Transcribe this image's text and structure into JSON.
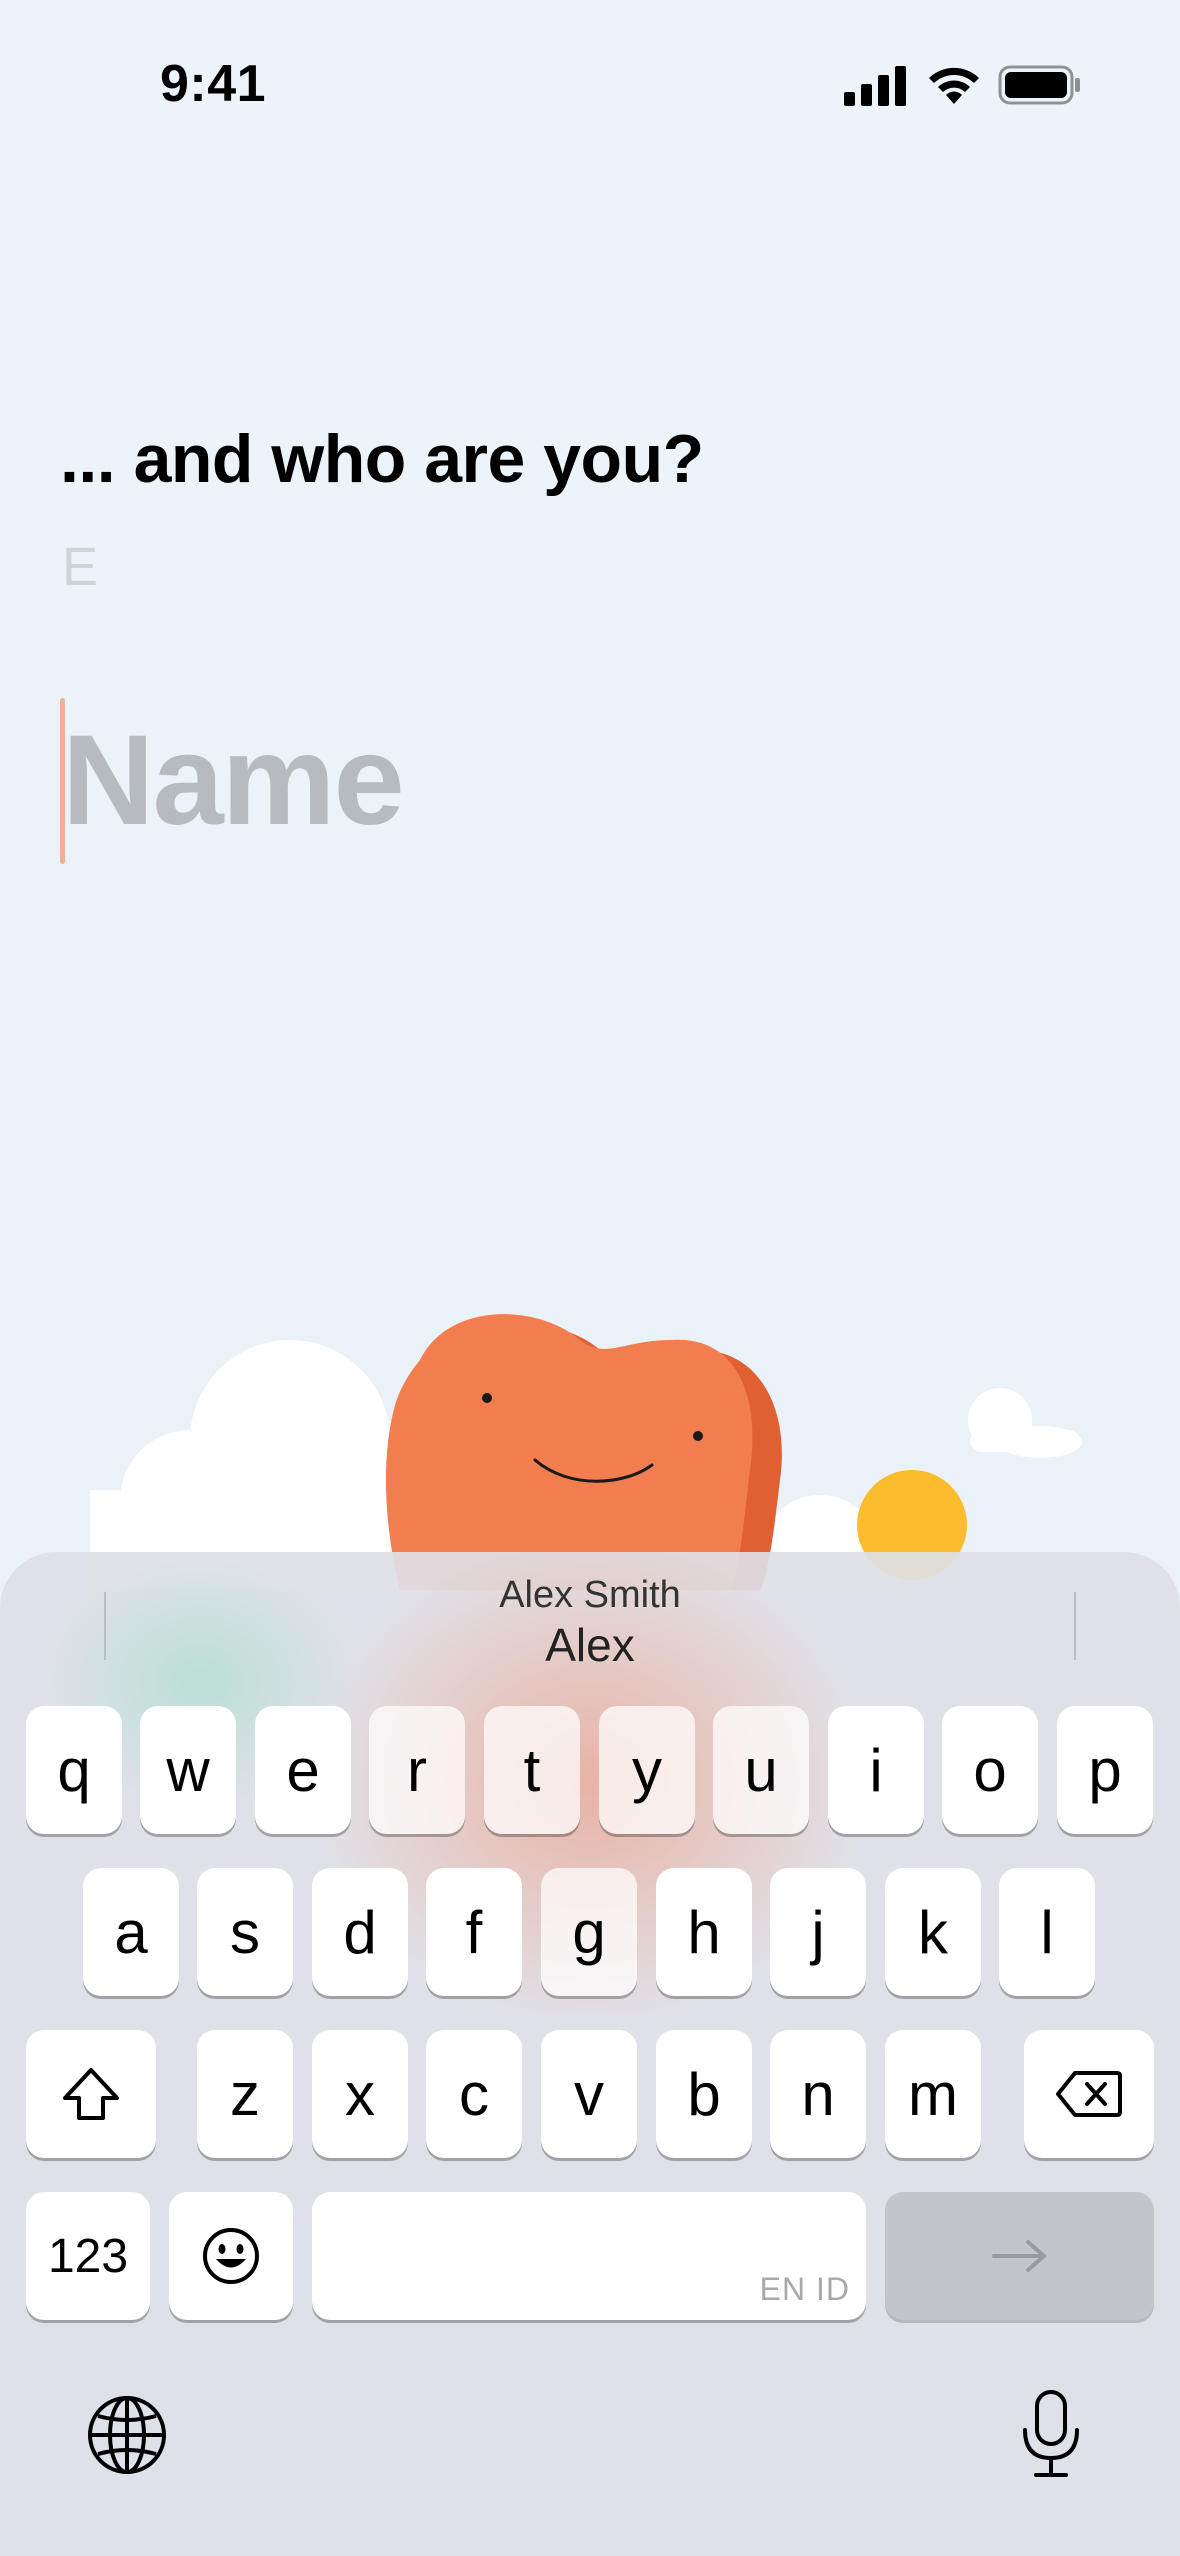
{
  "status_bar": {
    "time": "9:41",
    "icons": [
      "cellular-signal-icon",
      "wifi-icon",
      "battery-icon"
    ]
  },
  "prompt": {
    "question": "... and who are you?",
    "hint_letter": "E"
  },
  "name_field": {
    "placeholder": "Name",
    "value": ""
  },
  "keyboard": {
    "suggestions": {
      "small": "Alex Smith",
      "large": "Alex"
    },
    "row1": [
      "q",
      "w",
      "e",
      "r",
      "t",
      "y",
      "u",
      "i",
      "o",
      "p"
    ],
    "row2": [
      "a",
      "s",
      "d",
      "f",
      "g",
      "h",
      "j",
      "k",
      "l"
    ],
    "row3": [
      "z",
      "x",
      "c",
      "v",
      "b",
      "n",
      "m"
    ],
    "numbers_label": "123",
    "space_language": "EN ID",
    "icons": {
      "shift": "shift-icon",
      "delete": "delete-icon",
      "emoji": "emoji-icon",
      "return": "arrow-right-icon",
      "globe": "globe-icon",
      "mic": "microphone-icon"
    }
  },
  "colors": {
    "background": "#eaf2f8",
    "mascot": "#f27e50",
    "mascot_shadow": "#e05f33",
    "sun": "#fbbd2e",
    "caret": "#f0b09a"
  }
}
